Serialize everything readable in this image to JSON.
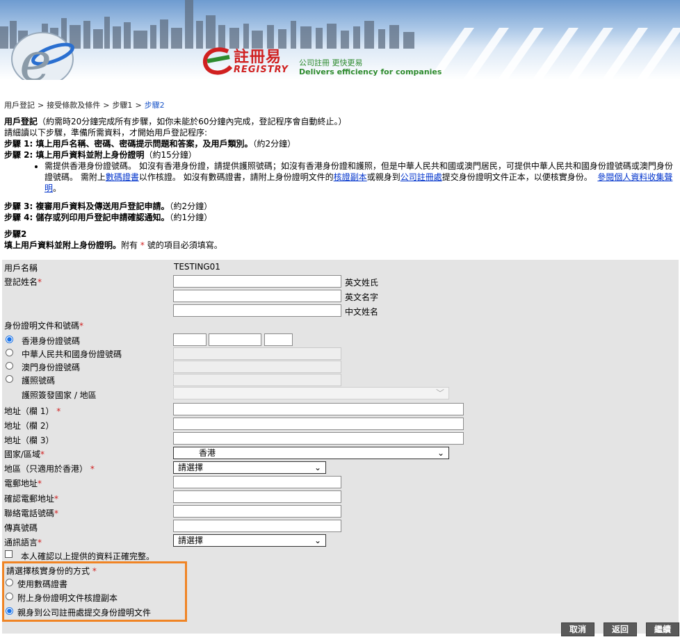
{
  "banner": {
    "logo_title": "註冊易",
    "logo_word": "REGISTRY",
    "tagline_cn": "公司註冊 更快更易",
    "tagline_en": "Delivers efficiency for companies"
  },
  "breadcrumb": [
    "用戶登記",
    "接受條款及條件",
    "步驟1",
    "步驟2"
  ],
  "intro": {
    "title": "用戶登記",
    "title_note": "（約需時20分鐘完成所有步驟，如你未能於60分鐘內完成，登記程序會自動終止。）",
    "read_note": "請細讀以下步驟，準備所需資料，才開始用戶登記程序:",
    "step1": "步驟 1: 填上用戶名稱、密碼、密碼提示問題和答案，及用戶類別。",
    "step1_time": "（約2分鐘）",
    "step2": "步驟 2: 填上用戶資料並附上身份證明",
    "step2_time": "（約15分鐘）",
    "bullet_part1": "需提供香港身份證號碼。 如沒有香港身份證，請提供護照號碼；如沒有香港身份證和護照，但是中華人民共和國或澳門居民，可提供中華人民共和國身份證號碼或澳門身份證號碼。 需附上",
    "bullet_link1": "數碼證書",
    "bullet_part2": "以作核證。 如沒有數碼證書，請附上身份證明文件的",
    "bullet_link2": "核證副本",
    "bullet_part3": "或親身到",
    "bullet_link3": "公司註冊處",
    "bullet_part4": "提交身份證明文件正本，以便核實身份。",
    "bullet_link4": "參閱個人資料收集聲明",
    "bullet_end": "。",
    "step3": "步驟 3: 複審用戶資料及傳送用戶登記申請。",
    "step3_time": "（約2分鐘）",
    "step4": "步驟 4: 儲存或列印用戶登記申請確認通知。",
    "step4_time": "（約1分鐘）",
    "current_step": "步驟2",
    "current_desc": "填上用戶資料並附上身份證明。",
    "required_note_a": "附有",
    "required_star": "*",
    "required_note_b": "號的項目必須填寫。"
  },
  "form": {
    "username_label": "用戶名稱",
    "username_value": "TESTING01",
    "name_label": "登記姓名",
    "surname_hint": "英文姓氏",
    "given_hint": "英文名字",
    "chinese_hint": "中文姓名",
    "id_label": "身份證明文件和號碼",
    "id_options": [
      "香港身份證號碼",
      "中華人民共和國身份證號碼",
      "澳門身份證號碼",
      "護照號碼"
    ],
    "passport_country_label": "護照簽發國家 / 地區",
    "addr1_label": "地址（欄 1）",
    "addr2_label": "地址（欄 2）",
    "addr3_label": "地址（欄 3）",
    "country_label": "國家/區域",
    "country_value": "香港",
    "district_label": "地區（只適用於香港）",
    "district_value": "請選擇",
    "email_label": "電郵地址",
    "email_confirm_label": "確認電郵地址",
    "phone_label": "聯絡電話號碼",
    "fax_label": "傳真號碼",
    "language_label": "通訊語言",
    "language_value": "請選擇",
    "confirm_label": "本人確認以上提供的資料正確完整。",
    "verify_label": "請選擇核實身份的方式",
    "verify_options": [
      "使用數碼證書",
      "附上身份證明文件核證副本",
      "親身到公司註冊處提交身份證明文件"
    ],
    "star": "*"
  },
  "buttons": {
    "cancel": "取消",
    "back": "返回",
    "continue": "繼續"
  }
}
